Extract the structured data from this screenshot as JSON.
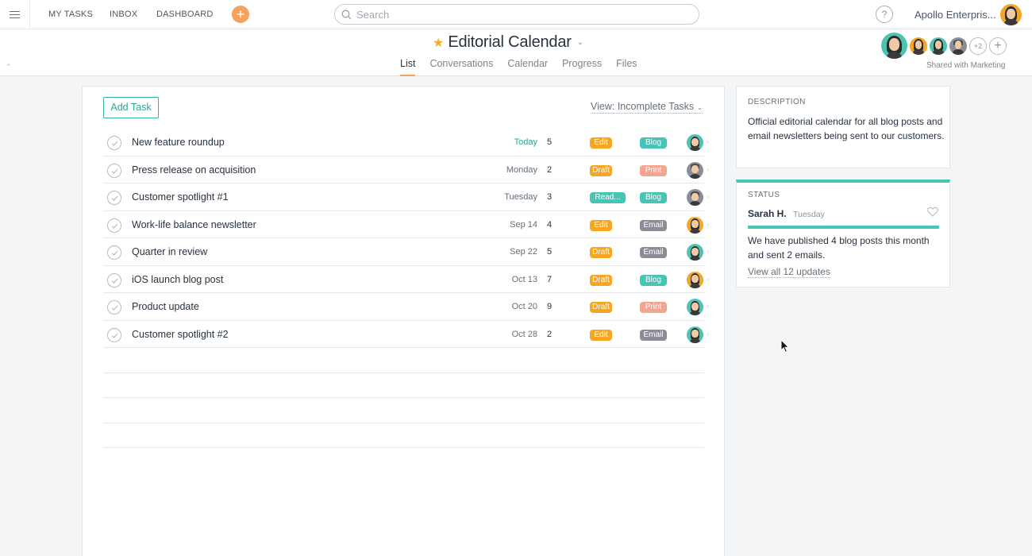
{
  "topbar": {
    "nav": [
      "MY TASKS",
      "INBOX",
      "DASHBOARD"
    ],
    "plus_glyph": "+",
    "search_placeholder": "Search",
    "help_glyph": "?",
    "org_name": "Apollo Enterpris..."
  },
  "project": {
    "title": "Editorial Calendar",
    "tabs": [
      "List",
      "Conversations",
      "Calendar",
      "Progress",
      "Files"
    ],
    "active_tab": "List",
    "extra_members_count": "+2",
    "shared_with": "Shared with Marketing"
  },
  "tasks_panel": {
    "add_task_label": "Add Task",
    "view_filter": "View: Incomplete Tasks",
    "tasks": [
      {
        "name": "New feature roundup",
        "due": "Today",
        "count": "5",
        "tag1": "Edit",
        "tag2": "Blog",
        "assignee": "teal"
      },
      {
        "name": "Press release on acquisition",
        "due": "Monday",
        "count": "2",
        "tag1": "Draft",
        "tag2": "Print",
        "assignee": "gray"
      },
      {
        "name": "Customer spotlight #1",
        "due": "Tuesday",
        "count": "3",
        "tag1": "Read...",
        "tag2": "Blog",
        "assignee": "gray"
      },
      {
        "name": "Work-life balance newsletter",
        "due": "Sep 14",
        "count": "4",
        "tag1": "Edit",
        "tag2": "Email",
        "assignee": "orange"
      },
      {
        "name": "Quarter in review",
        "due": "Sep 22",
        "count": "5",
        "tag1": "Draft",
        "tag2": "Email",
        "assignee": "teal"
      },
      {
        "name": "iOS launch blog post",
        "due": "Oct 13",
        "count": "7",
        "tag1": "Draft",
        "tag2": "Blog",
        "assignee": "orange"
      },
      {
        "name": "Product update",
        "due": "Oct 20",
        "count": "9",
        "tag1": "Draft",
        "tag2": "Print",
        "assignee": "teal"
      },
      {
        "name": "Customer spotlight #2",
        "due": "Oct 28",
        "count": "2",
        "tag1": "Edit",
        "tag2": "Email",
        "assignee": "teal"
      }
    ]
  },
  "description": {
    "label": "DESCRIPTION",
    "text": "Official editorial calendar for all blog posts and email newsletters being sent to our customers."
  },
  "status": {
    "label": "STATUS",
    "author": "Sarah H.",
    "date": "Tuesday",
    "text": "We have published 4 blog posts this month and sent 2 emails.",
    "link": "View all 12 updates"
  },
  "colors": {
    "accent_teal": "#44c5b5",
    "accent_orange": "#f5a623",
    "tag_salmon": "#f4a58f",
    "tag_gray": "#8e8a98"
  }
}
